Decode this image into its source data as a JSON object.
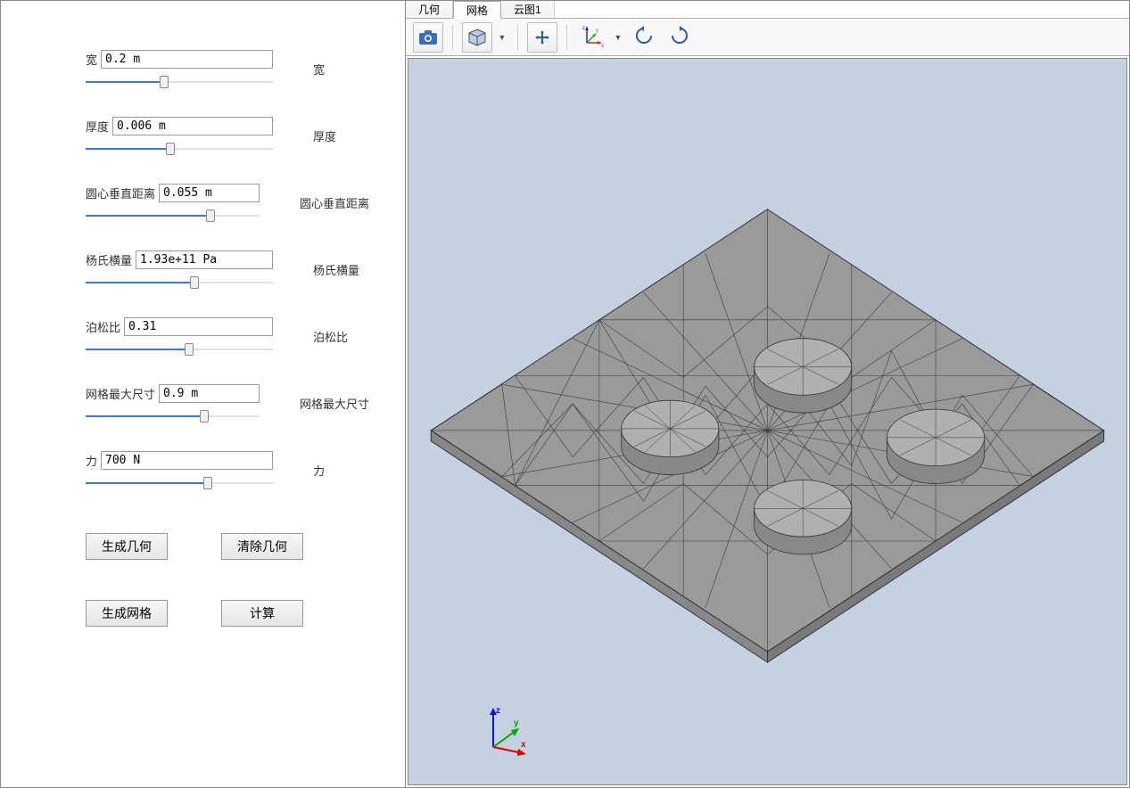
{
  "params": [
    {
      "label_left": "宽",
      "value": "0.2 m",
      "label_right": "宽",
      "fill": 42
    },
    {
      "label_left": "厚度",
      "value": "0.006 m",
      "label_right": "厚度",
      "fill": 45
    },
    {
      "label_left": "圆心垂直距离",
      "value": "0.055 m",
      "label_right": "圆心垂直距离",
      "fill": 72
    },
    {
      "label_left": "杨氏横量",
      "value": "1.93e+11 Pa",
      "label_right": "杨氏横量",
      "fill": 58
    },
    {
      "label_left": "泊松比",
      "value": "0.31",
      "label_right": "泊松比",
      "fill": 55
    },
    {
      "label_left": "网格最大尺寸",
      "value": "0.9 m",
      "label_right": "网格最大尺寸",
      "fill": 68
    },
    {
      "label_left": "力",
      "value": "700 N",
      "label_right": "力",
      "fill": 65
    }
  ],
  "buttons": {
    "gen_geom": "生成几何",
    "clear_geom": "清除几何",
    "gen_mesh": "生成网格",
    "compute": "计算"
  },
  "tabs": {
    "geometry": "几何",
    "mesh": "网格",
    "contour1": "云图1"
  }
}
